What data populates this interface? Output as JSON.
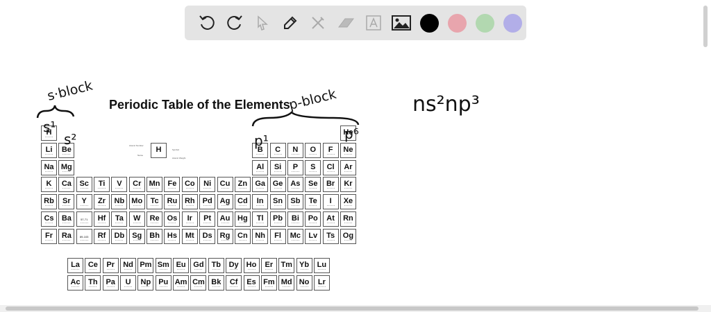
{
  "toolbar": {
    "tools": [
      "undo-icon",
      "redo-icon",
      "select-icon",
      "pen-icon",
      "tools-icon",
      "eraser-icon",
      "text-icon",
      "image-icon"
    ],
    "colors": [
      "#000000",
      "#e8a5ad",
      "#b2d8b0",
      "#b2aee8"
    ]
  },
  "document": {
    "title": "Periodic Table of the Elements",
    "legend": {
      "symbol": "H",
      "atomic_number": "Atomic Number",
      "name": "Name",
      "symbol_label": "Symbol",
      "weight": "Atomic Weight"
    },
    "main_rows": [
      [
        "H",
        "",
        "",
        "",
        "",
        "",
        "",
        "",
        "",
        "",
        "",
        "",
        "",
        "",
        "",
        "",
        "",
        "He"
      ],
      [
        "Li",
        "Be",
        "",
        "",
        "",
        "",
        "",
        "",
        "",
        "",
        "",
        "",
        "B",
        "C",
        "N",
        "O",
        "F",
        "Ne"
      ],
      [
        "Na",
        "Mg",
        "",
        "",
        "",
        "",
        "",
        "",
        "",
        "",
        "",
        "",
        "Al",
        "Si",
        "P",
        "S",
        "Cl",
        "Ar"
      ],
      [
        "K",
        "Ca",
        "Sc",
        "Ti",
        "V",
        "Cr",
        "Mn",
        "Fe",
        "Co",
        "Ni",
        "Cu",
        "Zn",
        "Ga",
        "Ge",
        "As",
        "Se",
        "Br",
        "Kr"
      ],
      [
        "Rb",
        "Sr",
        "Y",
        "Zr",
        "Nb",
        "Mo",
        "Tc",
        "Ru",
        "Rh",
        "Pd",
        "Ag",
        "Cd",
        "In",
        "Sn",
        "Sb",
        "Te",
        "I",
        "Xe"
      ],
      [
        "Cs",
        "Ba",
        "57-71",
        "Hf",
        "Ta",
        "W",
        "Re",
        "Os",
        "Ir",
        "Pt",
        "Au",
        "Hg",
        "Tl",
        "Pb",
        "Bi",
        "Po",
        "At",
        "Rn"
      ],
      [
        "Fr",
        "Ra",
        "89-103",
        "Rf",
        "Db",
        "Sg",
        "Bh",
        "Hs",
        "Mt",
        "Ds",
        "Rg",
        "Cn",
        "Nh",
        "Fl",
        "Mc",
        "Lv",
        "Ts",
        "Og"
      ]
    ],
    "f_rows": [
      [
        "La",
        "Ce",
        "Pr",
        "Nd",
        "Pm",
        "Sm",
        "Eu",
        "Gd",
        "Tb",
        "Dy",
        "Ho",
        "Er",
        "Tm",
        "Yb",
        "Lu"
      ],
      [
        "Ac",
        "Th",
        "Pa",
        "U",
        "Np",
        "Pu",
        "Am",
        "Cm",
        "Bk",
        "Cf",
        "Es",
        "Fm",
        "Md",
        "No",
        "Lr"
      ]
    ]
  },
  "annotations": {
    "s_block": "s·block",
    "p_block": "p-block",
    "s1": "s¹",
    "s2": "s²",
    "p1": "p¹",
    "p6": "p⁶",
    "config": "ns²np³"
  }
}
